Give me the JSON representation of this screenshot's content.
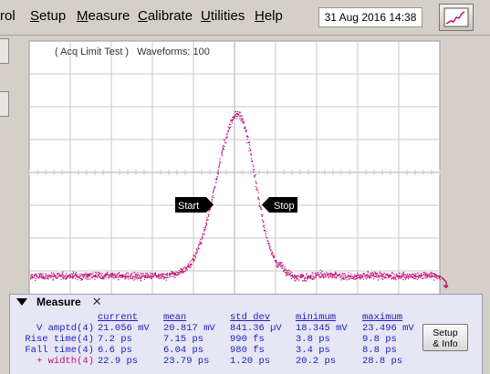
{
  "menu": {
    "items": [
      "rol",
      "Setup",
      "Measure",
      "Calibrate",
      "Utilities",
      "Help"
    ],
    "underline": [
      "",
      "S",
      "M",
      "C",
      "U",
      "H"
    ]
  },
  "datetime": "31 Aug 2016   14:38",
  "acquisition": {
    "mode": "( Acq Limit Test )",
    "waveforms": "Waveforms: 100"
  },
  "markers": {
    "start": "Start",
    "stop": "Stop"
  },
  "colors": {
    "trace": "#c0107a",
    "grid": "#c8c8c8",
    "screen": "#ffffff",
    "readout": "#2020c0"
  },
  "measure_panel": {
    "title": "Measure",
    "headers": [
      "current",
      "mean",
      "std dev",
      "minimum",
      "maximum"
    ],
    "rows": [
      {
        "label": "V amptd(4)",
        "active": false,
        "values": [
          "21.056 mV",
          "20.817 mV",
          "841.36 µV",
          "18.345 mV",
          "23.496 mV"
        ]
      },
      {
        "label": "Rise time(4)",
        "active": false,
        "values": [
          "7.2 ps",
          "7.15 ps",
          "990 fs",
          "3.8 ps",
          "9.8 ps"
        ]
      },
      {
        "label": "Fall time(4)",
        "active": false,
        "values": [
          "6.6 ps",
          "6.04 ps",
          "980 fs",
          "3.4 ps",
          "8.8 ps"
        ]
      },
      {
        "label": "+ width(4)",
        "active": true,
        "values": [
          "22.9 ps",
          "23.79 ps",
          "1.20 ps",
          "20.2 ps",
          "28.8 ps"
        ]
      }
    ],
    "setup_button": [
      "Setup",
      "& Info"
    ]
  }
}
